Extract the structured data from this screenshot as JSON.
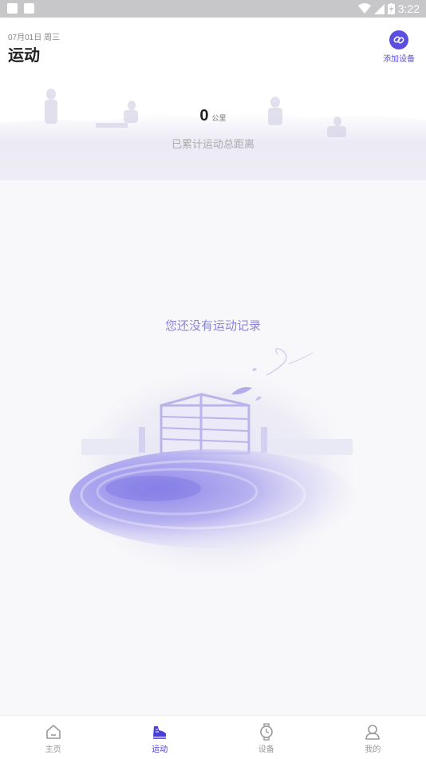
{
  "status_bar": {
    "time": "3:22"
  },
  "header": {
    "date": "07月01日 周三",
    "title": "运动",
    "add_device_label": "添加设备"
  },
  "summary": {
    "distance_value": "0",
    "distance_unit": "公里",
    "caption": "已累计运动总距离"
  },
  "empty_state": {
    "message": "您还没有运动记录"
  },
  "bottom_nav": {
    "items": [
      {
        "label": "主页",
        "icon": "home-icon"
      },
      {
        "label": "运动",
        "icon": "shoe-icon",
        "active": true
      },
      {
        "label": "设备",
        "icon": "watch-icon"
      },
      {
        "label": "我的",
        "icon": "profile-icon"
      }
    ]
  },
  "colors": {
    "accent": "#4a3fd6",
    "accent_soft": "#8a84d8"
  }
}
